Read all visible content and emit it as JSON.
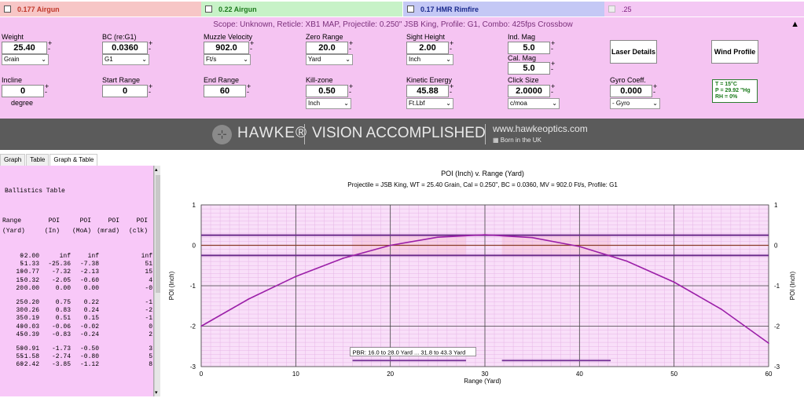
{
  "tabs": [
    {
      "label": "0.177 Airgun"
    },
    {
      "label": "0.22 Airgun"
    },
    {
      "label": "0.17 HMR Rimfire"
    },
    {
      "label": ".25"
    }
  ],
  "scope_line": "Scope: Unknown, Reticle: XB1 MAP, Projectile: 0.250\" JSB King, Profile: G1, Combo: 425fps Crossbow",
  "fields": {
    "weight": {
      "label": "Weight",
      "value": "25.40",
      "unit": "Grain"
    },
    "bc": {
      "label": "BC (re:G1)",
      "value": "0.0360",
      "unit": "G1"
    },
    "mv": {
      "label": "Muzzle Velocity",
      "value": "902.0",
      "unit": "Ft/s"
    },
    "zero": {
      "label": "Zero Range",
      "value": "20.0",
      "unit": "Yard"
    },
    "sight": {
      "label": "Sight Height",
      "value": "2.00",
      "unit": "Inch"
    },
    "indmag": {
      "label": "Ind. Mag",
      "value": "5.0"
    },
    "calmag": {
      "label": "Cal. Mag",
      "value": "5.0"
    },
    "incline": {
      "label": "Incline",
      "value": "0",
      "unit": "degree"
    },
    "startr": {
      "label": "Start Range",
      "value": "0"
    },
    "endr": {
      "label": "End Range",
      "value": "60"
    },
    "kill": {
      "label": "Kill-zone",
      "value": "0.50",
      "unit": "Inch"
    },
    "ke": {
      "label": "Kinetic Energy",
      "value": "45.88",
      "unit": "Ft.Lbf"
    },
    "click": {
      "label": "Click Size",
      "value": "2.0000",
      "unit": "c/moa"
    },
    "gyro": {
      "label": "Gyro Coeff.",
      "value": "0.000",
      "unit": "- Gyro"
    }
  },
  "buttons": {
    "laser": "Laser Details",
    "wind": "Wind Profile"
  },
  "atmos": {
    "t": "T = 15°C",
    "p": "P = 29.92 \"Hg",
    "rh": "RH = 0%"
  },
  "banner": {
    "brand": "HAWKE®",
    "tagline": "VISION ACCOMPLISHED",
    "url": "www.hawkeoptics.com",
    "uk": "Born in the UK"
  },
  "view_tabs": [
    "Graph",
    "Table",
    "Graph & Table"
  ],
  "table": {
    "title": "Ballistics Table",
    "headers": [
      [
        "Range",
        "(Yard)"
      ],
      [
        "POI",
        "(In)"
      ],
      [
        "POI",
        "(MoA)"
      ],
      [
        "POI",
        "(mrad)"
      ],
      [
        "POI",
        "(clk)"
      ]
    ],
    "rows": [
      [
        "0",
        "-2.00",
        "inf",
        "inf",
        "inf"
      ],
      [
        "5",
        "-1.33",
        "-25.36",
        "-7.38",
        "51"
      ],
      [
        "10",
        "-0.77",
        "-7.32",
        "-2.13",
        "15"
      ],
      [
        "15",
        "-0.32",
        "-2.05",
        "-0.60",
        "4"
      ],
      [
        "20",
        "0.00",
        "0.00",
        "0.00",
        "-0"
      ],
      [
        "25",
        "0.20",
        "0.75",
        "0.22",
        "-1"
      ],
      [
        "30",
        "0.26",
        "0.83",
        "0.24",
        "-2"
      ],
      [
        "35",
        "0.19",
        "0.51",
        "0.15",
        "-1"
      ],
      [
        "40",
        "-0.03",
        "-0.06",
        "-0.02",
        "0"
      ],
      [
        "45",
        "-0.39",
        "-0.83",
        "-0.24",
        "2"
      ],
      [
        "50",
        "-0.91",
        "-1.73",
        "-0.50",
        "3"
      ],
      [
        "55",
        "-1.58",
        "-2.74",
        "-0.80",
        "5"
      ],
      [
        "60",
        "-2.42",
        "-3.85",
        "-1.12",
        "8"
      ]
    ]
  },
  "chart_data": {
    "type": "line",
    "title": "POI (Inch) v. Range (Yard)",
    "subtitle": "Projectile = JSB King, WT = 25.40 Grain, Cal = 0.250\", BC = 0.0360, MV = 902.0 Ft/s, Profile: G1",
    "xlabel": "Range (Yard)",
    "ylabel": "POI (Inch)",
    "xlim": [
      0,
      60
    ],
    "ylim": [
      -3,
      1
    ],
    "xticks": [
      0,
      10,
      20,
      30,
      40,
      50,
      60
    ],
    "yticks": [
      1,
      0,
      -1,
      -2,
      -3
    ],
    "x": [
      0,
      5,
      10,
      15,
      20,
      25,
      30,
      35,
      40,
      45,
      50,
      55,
      60
    ],
    "y": [
      -2.0,
      -1.33,
      -0.77,
      -0.32,
      0.0,
      0.2,
      0.26,
      0.19,
      -0.03,
      -0.39,
      -0.91,
      -1.58,
      -2.42
    ],
    "killzone_lines": [
      0.25,
      0,
      -0.25
    ],
    "pbr_label": "PBR: 16.0 to 28.0 Yard ... 31.8 to 43.3 Yard",
    "pbr_ranges": [
      [
        16.0,
        28.0
      ],
      [
        31.8,
        43.3
      ]
    ],
    "colors": {
      "trajectory": "#9b1fa8",
      "band": "#6a2a8a",
      "zero": "#8a3a2a",
      "pbr": "#7a3a9a"
    },
    "grid": true
  }
}
